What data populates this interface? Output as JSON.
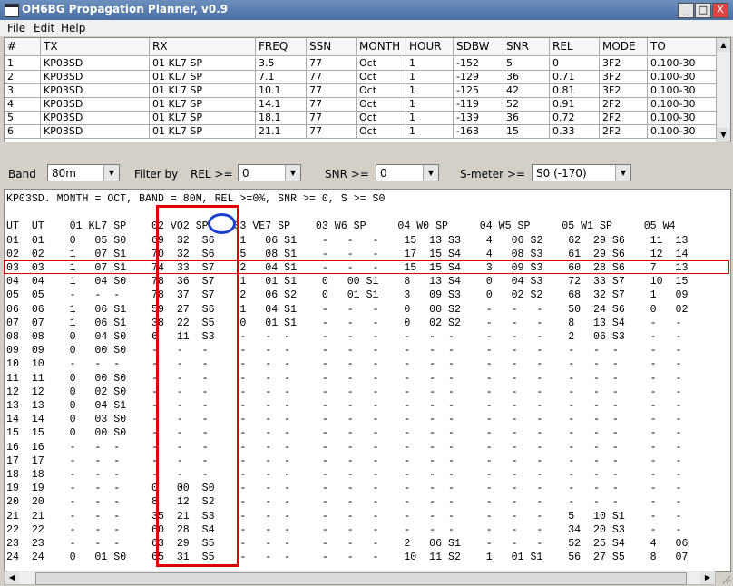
{
  "window": {
    "title": "OH6BG Propagation Planner, v0.9",
    "minimize": "_",
    "maximize": "□",
    "close": "X"
  },
  "menu": [
    "File",
    "Edit",
    "Help"
  ],
  "grid": {
    "columns": [
      "#",
      "TX",
      "RX",
      "FREQ",
      "SSN",
      "MONTH",
      "HOUR",
      "SDBW",
      "SNR",
      "REL",
      "MODE",
      "TO"
    ],
    "rows": [
      [
        "1",
        "KP03SD",
        "01 KL7 SP",
        "3.5",
        "77",
        "Oct",
        "1",
        "-152",
        "5",
        "0",
        "3F2",
        "0.100-30"
      ],
      [
        "2",
        "KP03SD",
        "01 KL7 SP",
        "7.1",
        "77",
        "Oct",
        "1",
        "-129",
        "36",
        "0.71",
        "3F2",
        "0.100-30"
      ],
      [
        "3",
        "KP03SD",
        "01 KL7 SP",
        "10.1",
        "77",
        "Oct",
        "1",
        "-125",
        "42",
        "0.81",
        "3F2",
        "0.100-30"
      ],
      [
        "4",
        "KP03SD",
        "01 KL7 SP",
        "14.1",
        "77",
        "Oct",
        "1",
        "-119",
        "52",
        "0.91",
        "2F2",
        "0.100-30"
      ],
      [
        "5",
        "KP03SD",
        "01 KL7 SP",
        "18.1",
        "77",
        "Oct",
        "1",
        "-139",
        "36",
        "0.72",
        "2F2",
        "0.100-30"
      ],
      [
        "6",
        "KP03SD",
        "01 KL7 SP",
        "21.1",
        "77",
        "Oct",
        "1",
        "-163",
        "15",
        "0.33",
        "2F2",
        "0.100-30"
      ]
    ]
  },
  "filters": {
    "band_label": "Band",
    "band_value": "80m",
    "filterby_label": "Filter by",
    "rel_label": "REL >=",
    "rel_value": "0",
    "snr_label": "SNR >=",
    "snr_value": "0",
    "smeter_label": "S-meter >=",
    "smeter_value": "S0 (-170)"
  },
  "output": {
    "summary": "KP03SD. MONTH = OCT, BAND = 80M, REL >=0%, SNR >= 0, S >= S0",
    "header": "UT  UT    01 KL7 SP    02 VO2 SP    03 VE7 SP    03 W6 SP     04 W0 SP     04 W5 SP     05 W1 SP     05 W4",
    "lines": [
      "01  01    0   05 S0    69  32  S6    1   06 S1    -   -   -    15  13 S3    4   06 S2    62  29 S6    11  13",
      "02  02    1   07 S1    70  32  S6    5   08 S1    -   -   -    17  15 S4    4   08 S3    61  29 S6    12  14",
      "03  03    1   07 S1    74  33  S7    2   04 S1    -   -   -    15  15 S4    3   09 S3    60  28 S6    7   13",
      "04  04    1   04 S0    78  36  S7    1   01 S1    0   00 S1    8   13 S4    0   04 S3    72  33 S7    10  15",
      "05  05    -   -  -     78  37  S7    2   06 S2    0   01 S1    3   09 S3    0   02 S2    68  32 S7    1   09",
      "06  06    1   06 S1    59  27  S6    1   04 S1    -   -   -    0   00 S2    -   -   -    50  24 S6    0   02",
      "07  07    1   06 S1    38  22  S5    0   01 S1    -   -   -    0   02 S2    -   -   -    8   13 S4    -   -",
      "08  08    0   04 S0    6   11  S3    -   -  -     -   -   -    -   -  -     -   -   -    2   06 S3    -   -",
      "09  09    0   00 S0    -   -   -     -   -  -     -   -   -    -   -  -     -   -   -    -   -  -     -   -",
      "10  10    -   -  -     -   -   -     -   -  -     -   -   -    -   -  -     -   -   -    -   -  -     -   -",
      "11  11    0   00 S0    -   -   -     -   -  -     -   -   -    -   -  -     -   -   -    -   -  -     -   -",
      "12  12    0   02 S0    -   -   -     -   -  -     -   -   -    -   -  -     -   -   -    -   -  -     -   -",
      "13  13    0   04 S1    -   -   -     -   -  -     -   -   -    -   -  -     -   -   -    -   -  -     -   -",
      "14  14    0   03 S0    -   -   -     -   -  -     -   -   -    -   -  -     -   -   -    -   -  -     -   -",
      "15  15    0   00 S0    -   -   -     -   -  -     -   -   -    -   -  -     -   -   -    -   -  -     -   -",
      "16  16    -   -  -     -   -   -     -   -  -     -   -   -    -   -  -     -   -   -    -   -  -     -   -",
      "17  17    -   -  -     -   -   -     -   -  -     -   -   -    -   -  -     -   -   -    -   -  -     -   -",
      "18  18    -   -  -     -   -   -     -   -  -     -   -   -    -   -  -     -   -   -    -   -  -     -   -",
      "19  19    -   -  -     0   00  S0    -   -  -     -   -   -    -   -  -     -   -   -    -   -  -     -   -",
      "20  20    -   -  -     8   12  S2    -   -  -     -   -   -    -   -  -     -   -   -    -   -  -     -   -",
      "21  21    -   -  -     35  21  S3    -   -  -     -   -   -    -   -  -     -   -   -    5   10 S1    -   -",
      "22  22    -   -  -     60  28  S4    -   -  -     -   -   -    -   -  -     -   -   -    34  20 S3    -   -",
      "23  23    -   -  -     63  29  S5    -   -  -     -   -   -    2   06 S1    -   -   -    52  25 S4    4   06",
      "24  24    0   01 S0    65  31  S5    -   -  -     -   -   -    10  11 S2    1   01 S1    56  27 S5    8   07"
    ]
  }
}
